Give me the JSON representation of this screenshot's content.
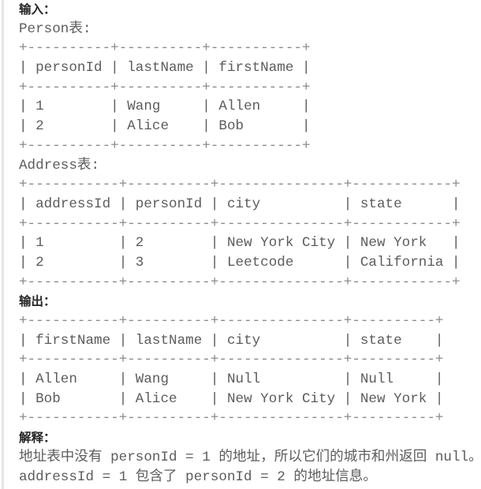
{
  "input_heading": "输入：",
  "person_label": "Person表:",
  "person_table": [
    "+----------+----------+-----------+",
    "| personId | lastName | firstName |",
    "+----------+----------+-----------+",
    "| 1        | Wang     | Allen     |",
    "| 2        | Alice    | Bob       |",
    "+----------+----------+-----------+"
  ],
  "address_label": "Address表:",
  "address_table": [
    "+-----------+----------+---------------+------------+",
    "| addressId | personId | city          | state      |",
    "+-----------+----------+---------------+------------+",
    "| 1         | 2        | New York City | New York   |",
    "| 2         | 3        | Leetcode      | California |",
    "+-----------+----------+---------------+------------+"
  ],
  "output_heading": "输出：",
  "output_table": [
    "+-----------+----------+---------------+----------+",
    "| firstName | lastName | city          | state    |",
    "+-----------+----------+---------------+----------+",
    "| Allen     | Wang     | Null          | Null     |",
    "| Bob       | Alice    | New York City | New York |",
    "+-----------+----------+---------------+----------+"
  ],
  "explanation_heading": "解释：",
  "explanation_lines": [
    "地址表中没有 personId = 1 的地址，所以它们的城市和州返回 null。",
    "addressId = 1 包含了 personId = 2 的地址信息。"
  ]
}
